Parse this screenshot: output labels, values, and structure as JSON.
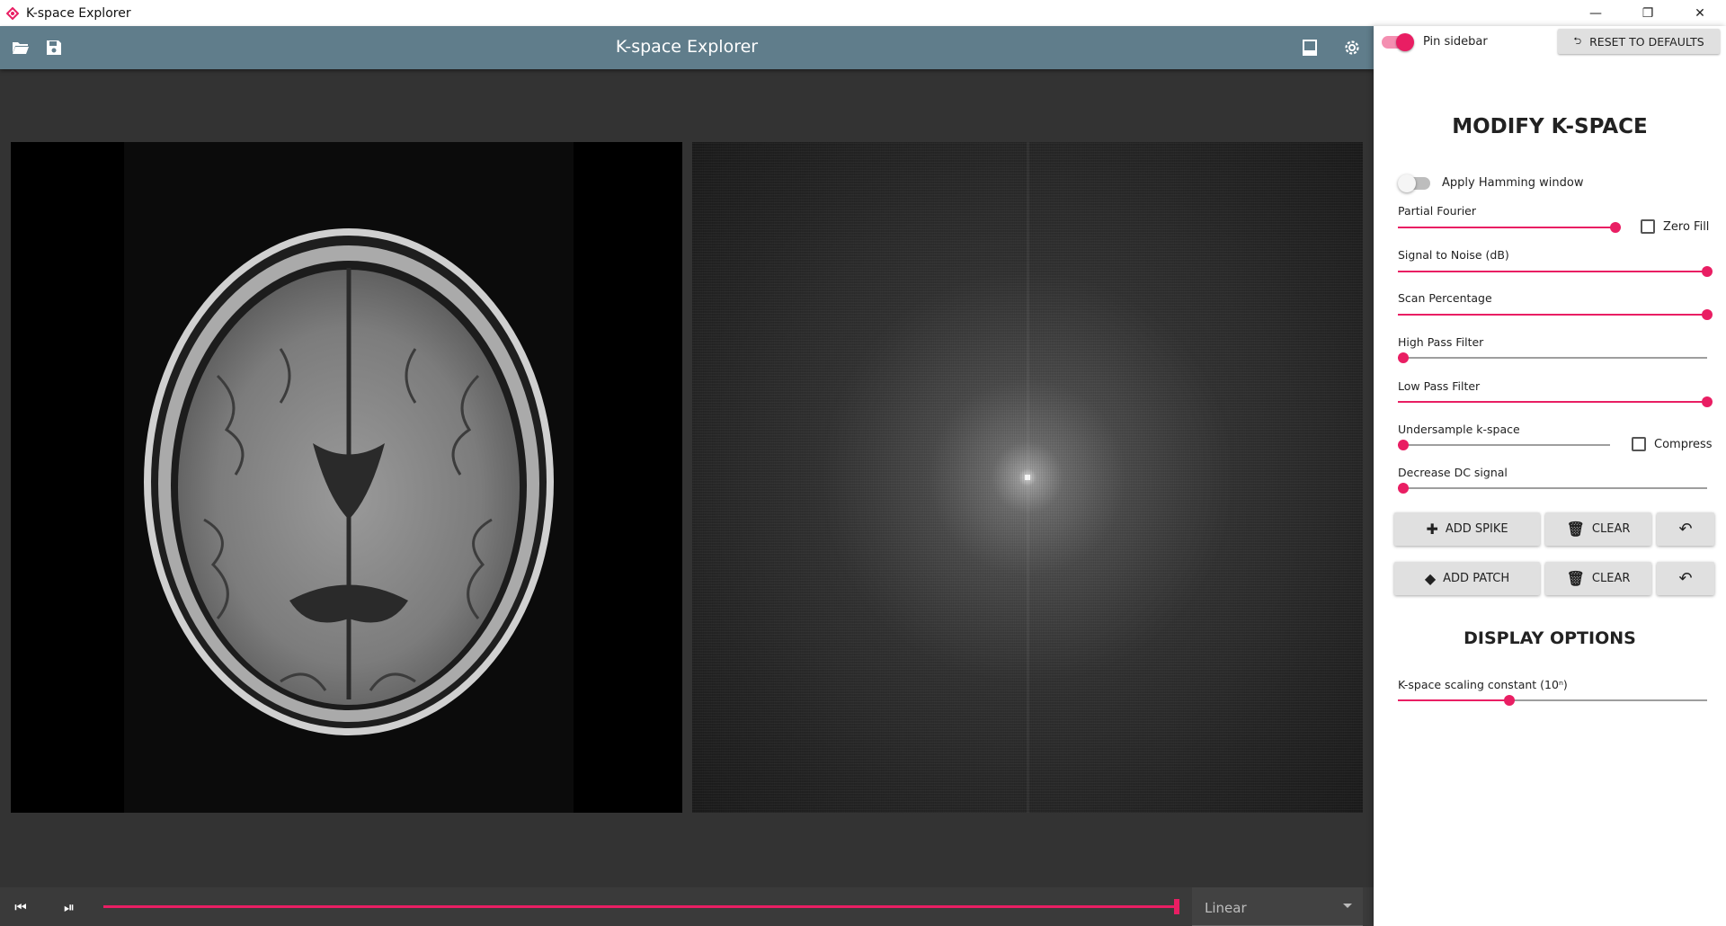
{
  "window": {
    "title": "K-space Explorer",
    "minimize": "—",
    "restore": "❐",
    "close": "✕"
  },
  "appbar": {
    "title": "K-space Explorer",
    "icons": [
      "folder-open-icon",
      "save-icon",
      "sidebar-toggle-icon",
      "settings-icon"
    ]
  },
  "playbar": {
    "selected_interpolation": "Linear"
  },
  "sidebar": {
    "pin_label": "Pin sidebar",
    "pin_enabled": true,
    "reset_label": "RESET TO DEFAULTS",
    "modify_title": "MODIFY K-SPACE",
    "hamming_label": "Apply Hamming window",
    "hamming_enabled": false,
    "sliders": {
      "partial_fourier": {
        "label": "Partial Fourier",
        "value": 1.0
      },
      "snr": {
        "label": "Signal to Noise (dB)",
        "value": 1.0
      },
      "scan_pct": {
        "label": "Scan Percentage",
        "value": 1.0
      },
      "high_pass": {
        "label": "High Pass Filter",
        "value": 0.0
      },
      "low_pass": {
        "label": "Low Pass Filter",
        "value": 1.0
      },
      "undersample": {
        "label": "Undersample k-space",
        "value": 0.0
      },
      "dc": {
        "label": "Decrease DC signal",
        "value": 0.0
      },
      "scaling": {
        "label": "K-space scaling constant (10ⁿ)",
        "value": 0.36
      }
    },
    "zero_fill_label": "Zero Fill",
    "compress_label": "Compress",
    "add_spike_label": "ADD SPIKE",
    "add_patch_label": "ADD PATCH",
    "clear_label": "CLEAR",
    "display_title": "DISPLAY OPTIONS"
  },
  "colors": {
    "accent": "#e91e63",
    "appbar": "#607d8b",
    "workspace": "#333333"
  }
}
